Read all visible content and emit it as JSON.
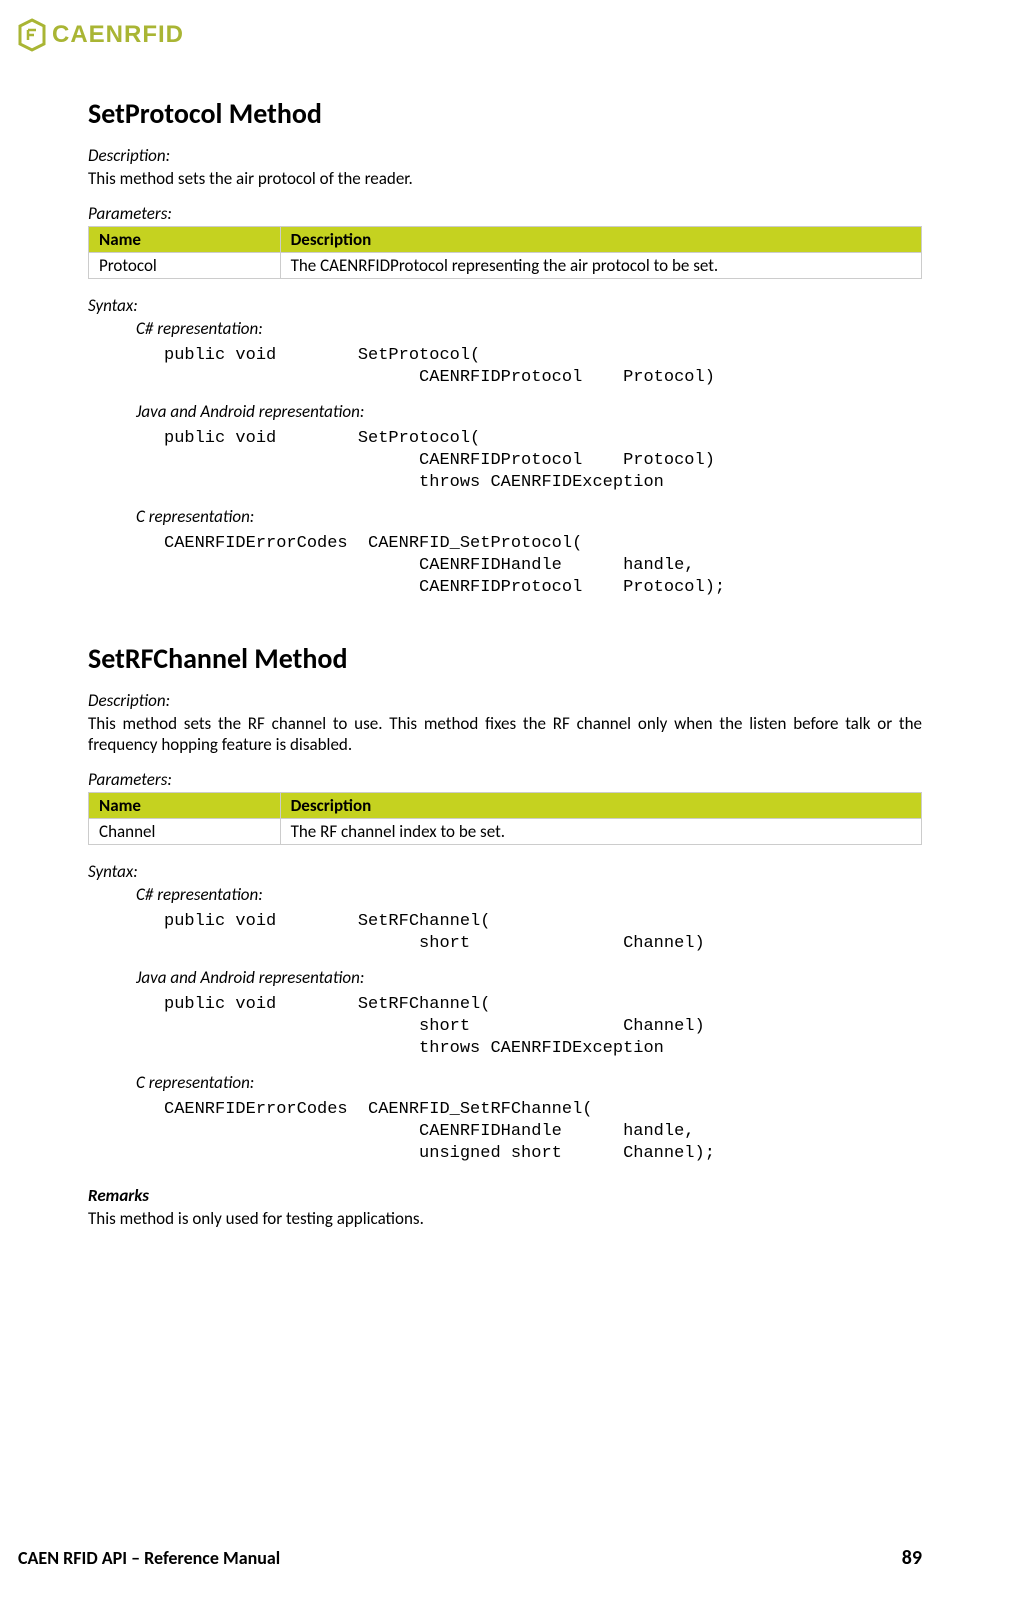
{
  "logo_text": "CAENRFID",
  "section1": {
    "title": "SetProtocol Method",
    "description_label": "Description:",
    "description_text": "This method sets the air protocol of the reader.",
    "parameters_label": "Parameters:",
    "table": {
      "header_name": "Name",
      "header_desc": "Description",
      "row_name": "Protocol",
      "row_desc": "The CAENRFIDProtocol representing the air protocol to be set."
    },
    "syntax_label": "Syntax:",
    "csharp_label": "C# representation:",
    "csharp_code": "public void        SetProtocol(\n                         CAENRFIDProtocol    Protocol)",
    "java_label": "Java and Android representation:",
    "java_code": "public void        SetProtocol(\n                         CAENRFIDProtocol    Protocol)\n                         throws CAENRFIDException",
    "c_label": "C representation:",
    "c_code": "CAENRFIDErrorCodes  CAENRFID_SetProtocol(\n                         CAENRFIDHandle      handle,\n                         CAENRFIDProtocol    Protocol);"
  },
  "section2": {
    "title": "SetRFChannel Method",
    "description_label": "Description:",
    "description_text": "This method sets the RF channel to use. This method fixes the RF channel only when the listen before talk or the frequency hopping feature is disabled.",
    "parameters_label": "Parameters:",
    "table": {
      "header_name": "Name",
      "header_desc": "Description",
      "row_name": "Channel",
      "row_desc": "The RF channel index to be set."
    },
    "syntax_label": "Syntax:",
    "csharp_label": "C# representation:",
    "csharp_code": "public void        SetRFChannel(\n                         short               Channel)",
    "java_label": "Java and Android representation:",
    "java_code": "public void        SetRFChannel(\n                         short               Channel)\n                         throws CAENRFIDException",
    "c_label": "C representation:",
    "c_code": "CAENRFIDErrorCodes  CAENRFID_SetRFChannel(\n                         CAENRFIDHandle      handle,\n                         unsigned short      Channel);",
    "remarks_label": "Remarks",
    "remarks_text": "This method is only used for testing applications."
  },
  "footer": {
    "title": "CAEN RFID API – Reference Manual",
    "page": "89"
  }
}
